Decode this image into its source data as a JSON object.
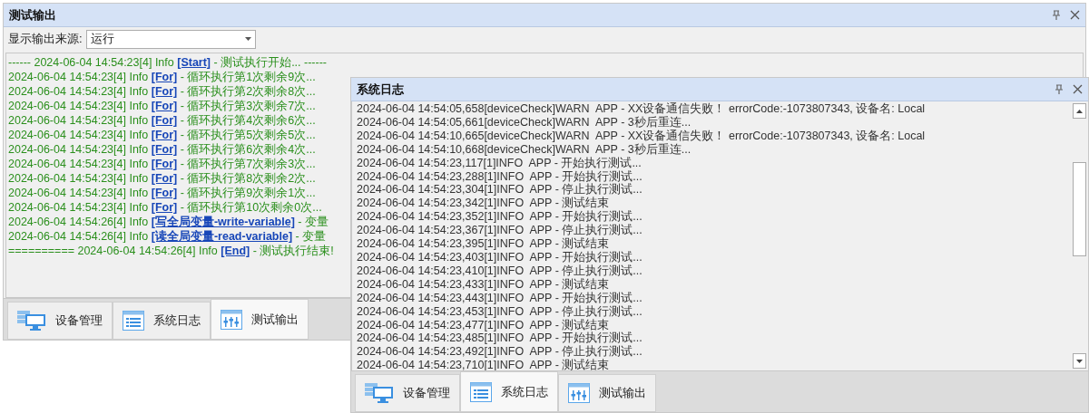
{
  "test_output_window": {
    "title": "测试输出",
    "source_label": "显示输出来源:",
    "source_value": "运行",
    "log": [
      {
        "prefix": "------ 2024-06-04 14:54:23[4] Info ",
        "link": "[Start]",
        "suffix": " - 测试执行开始... ------"
      },
      {
        "prefix": "2024-06-04 14:54:23[4] Info ",
        "link": "[For]",
        "suffix": " - 循环执行第1次剩余9次..."
      },
      {
        "prefix": "2024-06-04 14:54:23[4] Info ",
        "link": "[For]",
        "suffix": " - 循环执行第2次剩余8次..."
      },
      {
        "prefix": "2024-06-04 14:54:23[4] Info ",
        "link": "[For]",
        "suffix": " - 循环执行第3次剩余7次..."
      },
      {
        "prefix": "2024-06-04 14:54:23[4] Info ",
        "link": "[For]",
        "suffix": " - 循环执行第4次剩余6次..."
      },
      {
        "prefix": "2024-06-04 14:54:23[4] Info ",
        "link": "[For]",
        "suffix": " - 循环执行第5次剩余5次..."
      },
      {
        "prefix": "2024-06-04 14:54:23[4] Info ",
        "link": "[For]",
        "suffix": " - 循环执行第6次剩余4次..."
      },
      {
        "prefix": "2024-06-04 14:54:23[4] Info ",
        "link": "[For]",
        "suffix": " - 循环执行第7次剩余3次..."
      },
      {
        "prefix": "2024-06-04 14:54:23[4] Info ",
        "link": "[For]",
        "suffix": " - 循环执行第8次剩余2次..."
      },
      {
        "prefix": "2024-06-04 14:54:23[4] Info ",
        "link": "[For]",
        "suffix": " - 循环执行第9次剩余1次..."
      },
      {
        "prefix": "2024-06-04 14:54:23[4] Info ",
        "link": "[For]",
        "suffix": " - 循环执行第10次剩余0次..."
      },
      {
        "prefix": "2024-06-04 14:54:26[4] Info ",
        "link": "[写全局变量-write-variable]",
        "suffix": " - 变量"
      },
      {
        "prefix": "2024-06-04 14:54:26[4] Info ",
        "link": "[读全局变量-read-variable]",
        "suffix": " - 变量"
      },
      {
        "prefix": "========== 2024-06-04 14:54:26[4] Info ",
        "link": "[End]",
        "suffix": " - 测试执行结束!"
      }
    ],
    "tabs": [
      {
        "label": "设备管理",
        "kind": "devices",
        "selected": false
      },
      {
        "label": "系统日志",
        "kind": "log",
        "selected": false
      },
      {
        "label": "测试输出",
        "kind": "output",
        "selected": true
      }
    ]
  },
  "system_log_window": {
    "title": "系统日志",
    "log": [
      "2024-06-04 14:54:05,658[deviceCheck]WARN  APP - XX设备通信失败！ errorCode:-1073807343, 设备名: Local",
      "2024-06-04 14:54:05,661[deviceCheck]WARN  APP - 3秒后重连...",
      "2024-06-04 14:54:10,665[deviceCheck]WARN  APP - XX设备通信失败！ errorCode:-1073807343, 设备名: Local",
      "2024-06-04 14:54:10,668[deviceCheck]WARN  APP - 3秒后重连...",
      "2024-06-04 14:54:23,117[1]INFO  APP - 开始执行测试...",
      "2024-06-04 14:54:23,288[1]INFO  APP - 开始执行测试...",
      "2024-06-04 14:54:23,304[1]INFO  APP - 停止执行测试...",
      "2024-06-04 14:54:23,342[1]INFO  APP - 测试结束",
      "2024-06-04 14:54:23,352[1]INFO  APP - 开始执行测试...",
      "2024-06-04 14:54:23,367[1]INFO  APP - 停止执行测试...",
      "2024-06-04 14:54:23,395[1]INFO  APP - 测试结束",
      "2024-06-04 14:54:23,403[1]INFO  APP - 开始执行测试...",
      "2024-06-04 14:54:23,410[1]INFO  APP - 停止执行测试...",
      "2024-06-04 14:54:23,433[1]INFO  APP - 测试结束",
      "2024-06-04 14:54:23,443[1]INFO  APP - 开始执行测试...",
      "2024-06-04 14:54:23,453[1]INFO  APP - 停止执行测试...",
      "2024-06-04 14:54:23,477[1]INFO  APP - 测试结束",
      "2024-06-04 14:54:23,485[1]INFO  APP - 开始执行测试...",
      "2024-06-04 14:54:23,492[1]INFO  APP - 停止执行测试...",
      "2024-06-04 14:54:23,710[1]INFO  APP - 测试结束"
    ],
    "tabs": [
      {
        "label": "设备管理",
        "kind": "devices",
        "selected": false
      },
      {
        "label": "系统日志",
        "kind": "log",
        "selected": true
      },
      {
        "label": "测试输出",
        "kind": "output",
        "selected": false
      }
    ]
  }
}
